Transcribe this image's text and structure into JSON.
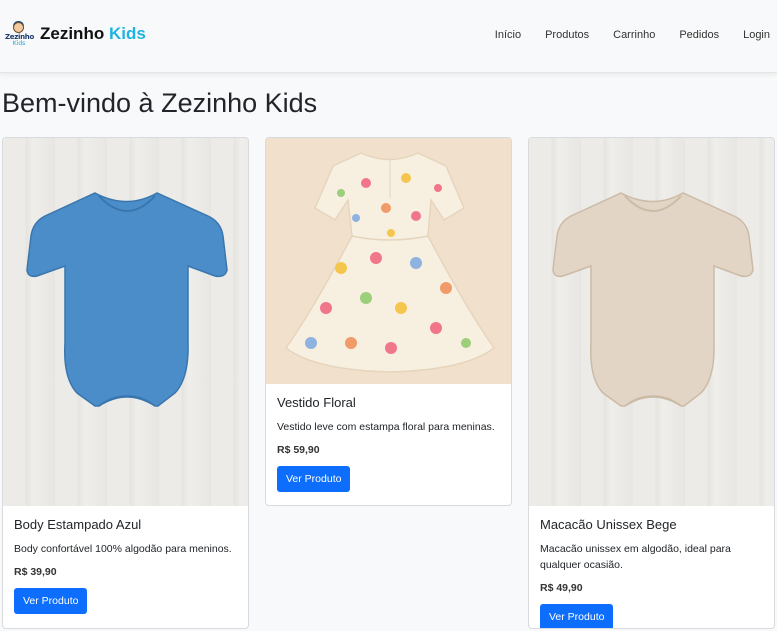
{
  "brand": {
    "name_part1": "Zezinho",
    "name_part2": "Kids",
    "logo_text_1": "Zezinho",
    "logo_text_2": "Kids"
  },
  "nav": {
    "items": [
      "Início",
      "Produtos",
      "Carrinho",
      "Pedidos",
      "Login"
    ]
  },
  "page": {
    "title": "Bem-vindo à Zezinho Kids"
  },
  "products": [
    {
      "name": "Body Estampado Azul",
      "description": "Body confortável 100% algodão para meninos.",
      "price": "R$ 39,90",
      "button": "Ver Produto",
      "image_icon": "blue-bodysuit-image",
      "color": "#4a8dc9"
    },
    {
      "name": "Vestido Floral",
      "description": "Vestido leve com estampa floral para meninas.",
      "price": "R$ 59,90",
      "button": "Ver Produto",
      "image_icon": "floral-dress-image",
      "color": "#f3e9dc"
    },
    {
      "name": "Macacão Unissex Bege",
      "description": "Macacão unissex em algodão, ideal para qualquer ocasião.",
      "price": "R$ 49,90",
      "button": "Ver Produto",
      "image_icon": "beige-romper-image",
      "color": "#e2d5c5"
    }
  ]
}
